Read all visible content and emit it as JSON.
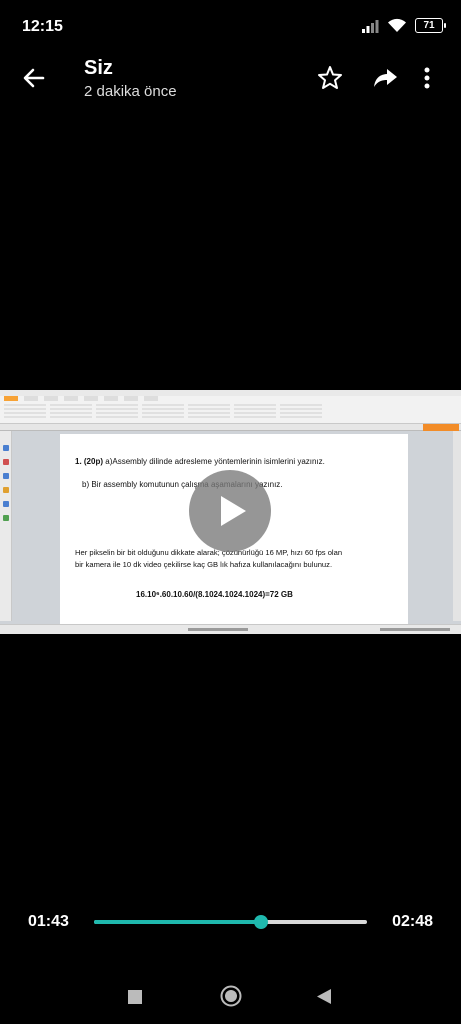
{
  "status_bar": {
    "time": "12:15",
    "battery": "71"
  },
  "header": {
    "title": "Siz",
    "subtitle": "2 dakika önce"
  },
  "actions": [
    "star-icon",
    "share-icon",
    "more-vert-icon"
  ],
  "document": {
    "q1_number": "1. (20p)",
    "q1_text": "a)Assembly dilinde adresleme yöntemlerinin isimlerini yazınız.",
    "q1_b": "b) Bir assembly komutunun çalışma aşamalarını yazınız.",
    "q2_text": "Her pikselin bir bit olduğunu dikkate alarak; çözünürlüğü 16 MP, hızı 60 fps olan bir kamera ile 10 dk video çekilirse kaç GB lık hafıza kullanılacağını bulunuz.",
    "answer": "16.10⁶.60.10.60/(8.1024.1024.1024)=72 GB"
  },
  "player": {
    "current_time": "01:43",
    "total_time": "02:48",
    "progress": 0.613,
    "accent": "#1fb9ae"
  },
  "navbar": [
    "recents-icon",
    "home-icon",
    "back-icon"
  ]
}
